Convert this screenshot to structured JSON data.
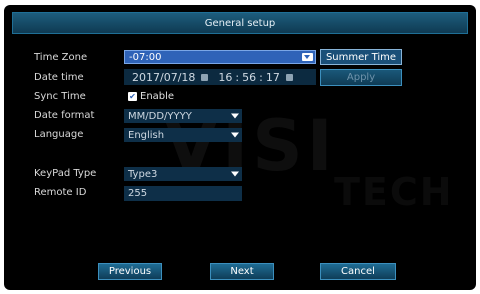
{
  "title": "General setup",
  "watermark": {
    "main": "VISI",
    "sub": "TECH"
  },
  "fields": {
    "time_zone": {
      "label": "Time Zone",
      "value": "-07:00"
    },
    "date_time": {
      "label": "Date time",
      "date": "2017/07/18",
      "hour": "16",
      "minute": "56",
      "second": "17"
    },
    "sync_time": {
      "label": "Sync Time",
      "checkbox_label": "Enable",
      "checked": true
    },
    "date_format": {
      "label": "Date format",
      "value": "MM/DD/YYYY"
    },
    "language": {
      "label": "Language",
      "value": "English"
    },
    "keypad_type": {
      "label": "KeyPad Type",
      "value": "Type3"
    },
    "remote_id": {
      "label": "Remote ID",
      "value": "255"
    }
  },
  "buttons": {
    "summer_time": "Summer Time",
    "apply": "Apply",
    "previous": "Previous",
    "next": "Next",
    "cancel": "Cancel"
  },
  "icons": {
    "check": "✔"
  },
  "colors": {
    "background": "#000000",
    "accent": "#2f63b8",
    "field": "#0e2f48"
  }
}
